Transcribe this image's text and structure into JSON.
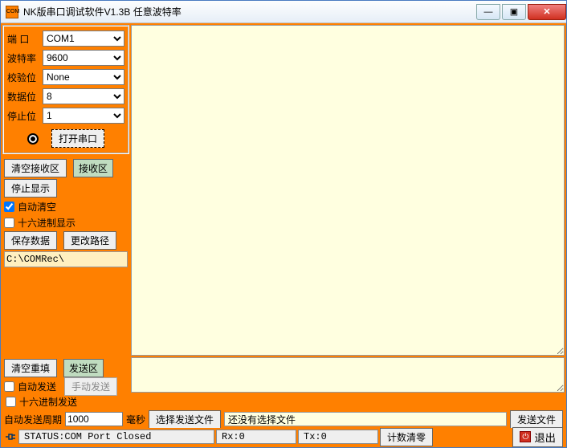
{
  "window": {
    "title": "NK版串口调试软件V1.3B  任意波特率",
    "icon_label": "COM"
  },
  "config": {
    "port_label": "端  口",
    "port_value": "COM1",
    "baud_label": "波特率",
    "baud_value": "9600",
    "parity_label": "校验位",
    "parity_value": "None",
    "databits_label": "数据位",
    "databits_value": "8",
    "stopbits_label": "停止位",
    "stopbits_value": "1",
    "open_button": "打开串口"
  },
  "rx_ctrl": {
    "clear_rx": "清空接收区",
    "rx_header": "接收区",
    "stop_display": "停止显示",
    "auto_clear_label": "自动清空",
    "auto_clear_checked": true,
    "hex_display_label": "十六进制显示",
    "hex_display_checked": false,
    "save_data": "保存数据",
    "change_path": "更改路径",
    "path_value": "C:\\COMRec\\"
  },
  "tx_ctrl": {
    "clear_tx": "清空重填",
    "tx_header": "发送区",
    "auto_send_label": "自动发送",
    "auto_send_checked": false,
    "manual_send": "手动发送",
    "hex_send_label": "十六进制发送",
    "hex_send_checked": false,
    "period_label": "自动发送周期",
    "period_value": "1000",
    "period_unit": "毫秒",
    "select_file": "选择发送文件",
    "file_display": "还没有选择文件",
    "send_file": "发送文件"
  },
  "status": {
    "main": "STATUS:COM Port Closed",
    "rx": "Rx:0",
    "tx": "Tx:0",
    "reset_counter": "计数清零",
    "exit": "退出"
  }
}
